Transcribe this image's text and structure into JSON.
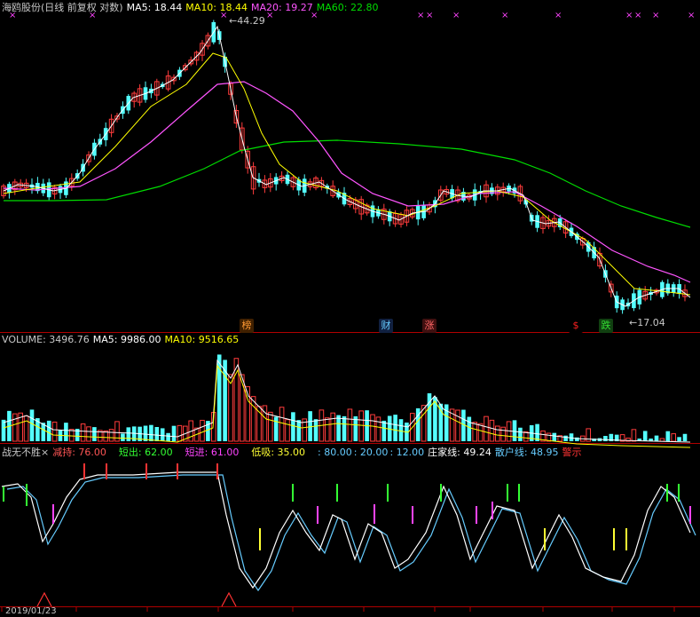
{
  "colors": {
    "up": "#ff3c3c",
    "down": "#54ffff",
    "ma5": "#ffffff",
    "ma10": "#ffff00",
    "ma20": "#ff55ff",
    "ma60": "#00dd00",
    "frame": "#b00000",
    "bg": "#000000"
  },
  "price_header": {
    "title": "海鸥股份(日线 前复权 对数)",
    "ma5": "MA5: 18.44",
    "ma10": "MA10: 18.44",
    "ma20": "MA20: 19.27",
    "ma60": "MA60: 22.80"
  },
  "annotations": {
    "high": "44.29",
    "low": "17.04"
  },
  "event_flags": [
    {
      "label": "榜",
      "color": "#ff9933",
      "bg": "#402000"
    },
    {
      "label": "财",
      "color": "#66ccff",
      "bg": "#102040"
    },
    {
      "label": "涨",
      "color": "#ff6666",
      "bg": "#401010"
    },
    {
      "label": "$",
      "color": "#ff2020",
      "bg": "#000000"
    },
    {
      "label": "跌",
      "color": "#33dd33",
      "bg": "#104010"
    }
  ],
  "volume_header": {
    "title": "VOLUME: 3496.76",
    "ma5": "MA5: 9986.00",
    "ma10": "MA10: 9516.65"
  },
  "indicator_header": {
    "name": "战无不胜",
    "close_icon": "close-icon",
    "jiancang": "减持: 76.00",
    "duanchu": "短出: 62.00",
    "duanjin": "短进: 61.00",
    "dixi": "低吸: 35.00",
    "l80": ": 80.00",
    "l20": ": 20.00",
    "l12": ": 12.00",
    "zhuangjia": "庄家线: 49.24",
    "sanhu": "散户线: 48.95",
    "warn": "警示"
  },
  "date_axis": {
    "start": "2019/01/23"
  },
  "chart_data": {
    "type": "candlestick",
    "scale": "log",
    "ylim": [
      16,
      48
    ],
    "price_high": 44.29,
    "price_low": 17.04,
    "ma_latest": {
      "MA5": 18.44,
      "MA10": 18.44,
      "MA20": 19.27,
      "MA60": 22.8
    },
    "volume_latest": 3496.76,
    "volume_ma_latest": {
      "MA5": 9986.0,
      "MA10": 9516.65
    },
    "oscillator_latest": {
      "zhuangjia": 49.24,
      "sanhu": 48.95
    },
    "oscillator_levels": [
      80,
      20,
      12
    ]
  }
}
